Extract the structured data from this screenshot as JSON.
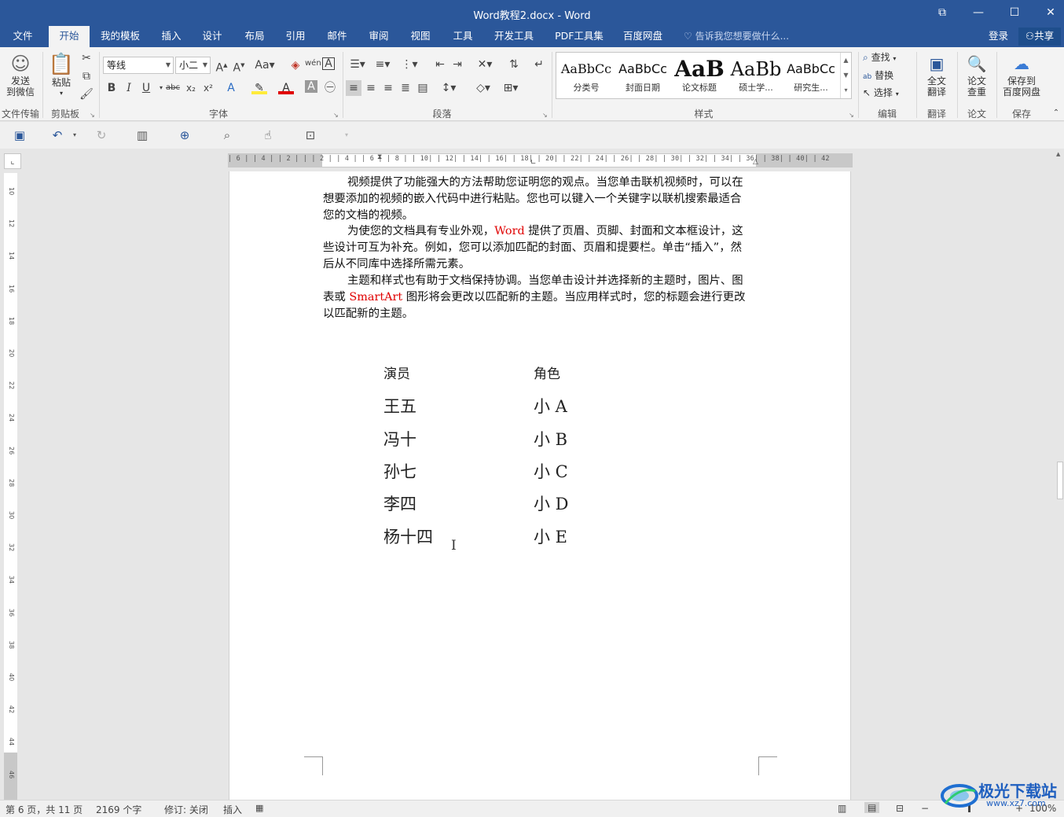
{
  "window": {
    "title": "Word教程2.docx - Word"
  },
  "tabs": [
    "文件",
    "开始",
    "我的模板",
    "插入",
    "设计",
    "布局",
    "引用",
    "邮件",
    "审阅",
    "视图",
    "工具",
    "开发工具",
    "PDF工具集",
    "百度网盘"
  ],
  "tell_me": "告诉我您想要做什么...",
  "account": {
    "login": "登录",
    "share": "共享"
  },
  "ribbon": {
    "send_wechat": "发送\n到微信",
    "file_transfer": "文件传输",
    "paste": "粘贴",
    "clipboard": "剪贴板",
    "font_name": "等线",
    "font_size": "小二",
    "font_group": "字体",
    "paragraph_group": "段落",
    "styles_group": "样式",
    "styles": [
      {
        "sample": "AaBbCc",
        "name": "分类号"
      },
      {
        "sample": "AaBbCc",
        "name": "封面日期"
      },
      {
        "sample": "AaB",
        "name": "论文标题"
      },
      {
        "sample": "AaBb",
        "name": "硕士学..."
      },
      {
        "sample": "AaBbCc",
        "name": "研究生..."
      }
    ],
    "find": "查找",
    "replace": "替换",
    "select": "选择",
    "edit_group": "编辑",
    "full_translate": "全文\n翻译",
    "translate_group": "翻译",
    "paper_check": "论文\n查重",
    "paper_group": "论文",
    "save_baidu": "保存到\n百度网盘",
    "save_group": "保存"
  },
  "ruler": {
    "horizontal": "| 6 |  | 4 |  | 2 |  |     | 2 |  | 4 |  | 6 |  | 8 |  | 10|  | 12|  | 14|  | 16|  | 18|  | 20|  | 22|  | 24|  | 26|  | 28|  | 30|  | 32|  | 34|  | 36|  | 38|  | 40|  | 42",
    "vertical": [
      "10",
      "12",
      "14",
      "16",
      "18",
      "20",
      "22",
      "24",
      "26",
      "28",
      "30",
      "32",
      "34",
      "36",
      "38",
      "40",
      "42",
      "44",
      "46"
    ]
  },
  "document": {
    "paragraphs": [
      {
        "segments": [
          "视频提供了功能强大的方法帮助您证明您的观点。当您单击联机视频时，可以在想要添加的视频的嵌入代码中进行粘贴。您也可以键入一个关键字以联机搜索最适合您的文档的视频。"
        ]
      },
      {
        "before": "为使您的文档具有专业外观，",
        "red": "Word",
        "after": " 提供了页眉、页脚、封面和文本框设计，这些设计可互为补充。例如，您可以添加匹配的封面、页眉和提要栏。单击“插入”，然后从不同库中选择所需元素。"
      },
      {
        "before": "主题和样式也有助于文档保持协调。当您单击设计并选择新的主题时，图片、图表或 ",
        "red": "SmartArt",
        "after": " 图形将会更改以匹配新的主题。当应用样式时，您的标题会进行更改以匹配新的主题。"
      }
    ],
    "table": {
      "headers": [
        "演员",
        "角色"
      ],
      "rows": [
        [
          "王五",
          "小 A"
        ],
        [
          "冯十",
          "小 B"
        ],
        [
          "孙七",
          "小 C"
        ],
        [
          "李四",
          "小 D"
        ],
        [
          "杨十四",
          "小 E"
        ]
      ]
    }
  },
  "status": {
    "page": "第 6 页，共 11 页",
    "words": "2169 个字",
    "track": "修订: 关闭",
    "insert": "插入",
    "zoom": "100%"
  },
  "watermark": {
    "text": "极光下载站",
    "url": "www.xz7.com"
  },
  "colors": {
    "brand": "#2b579a",
    "red_text": "#e00000"
  }
}
